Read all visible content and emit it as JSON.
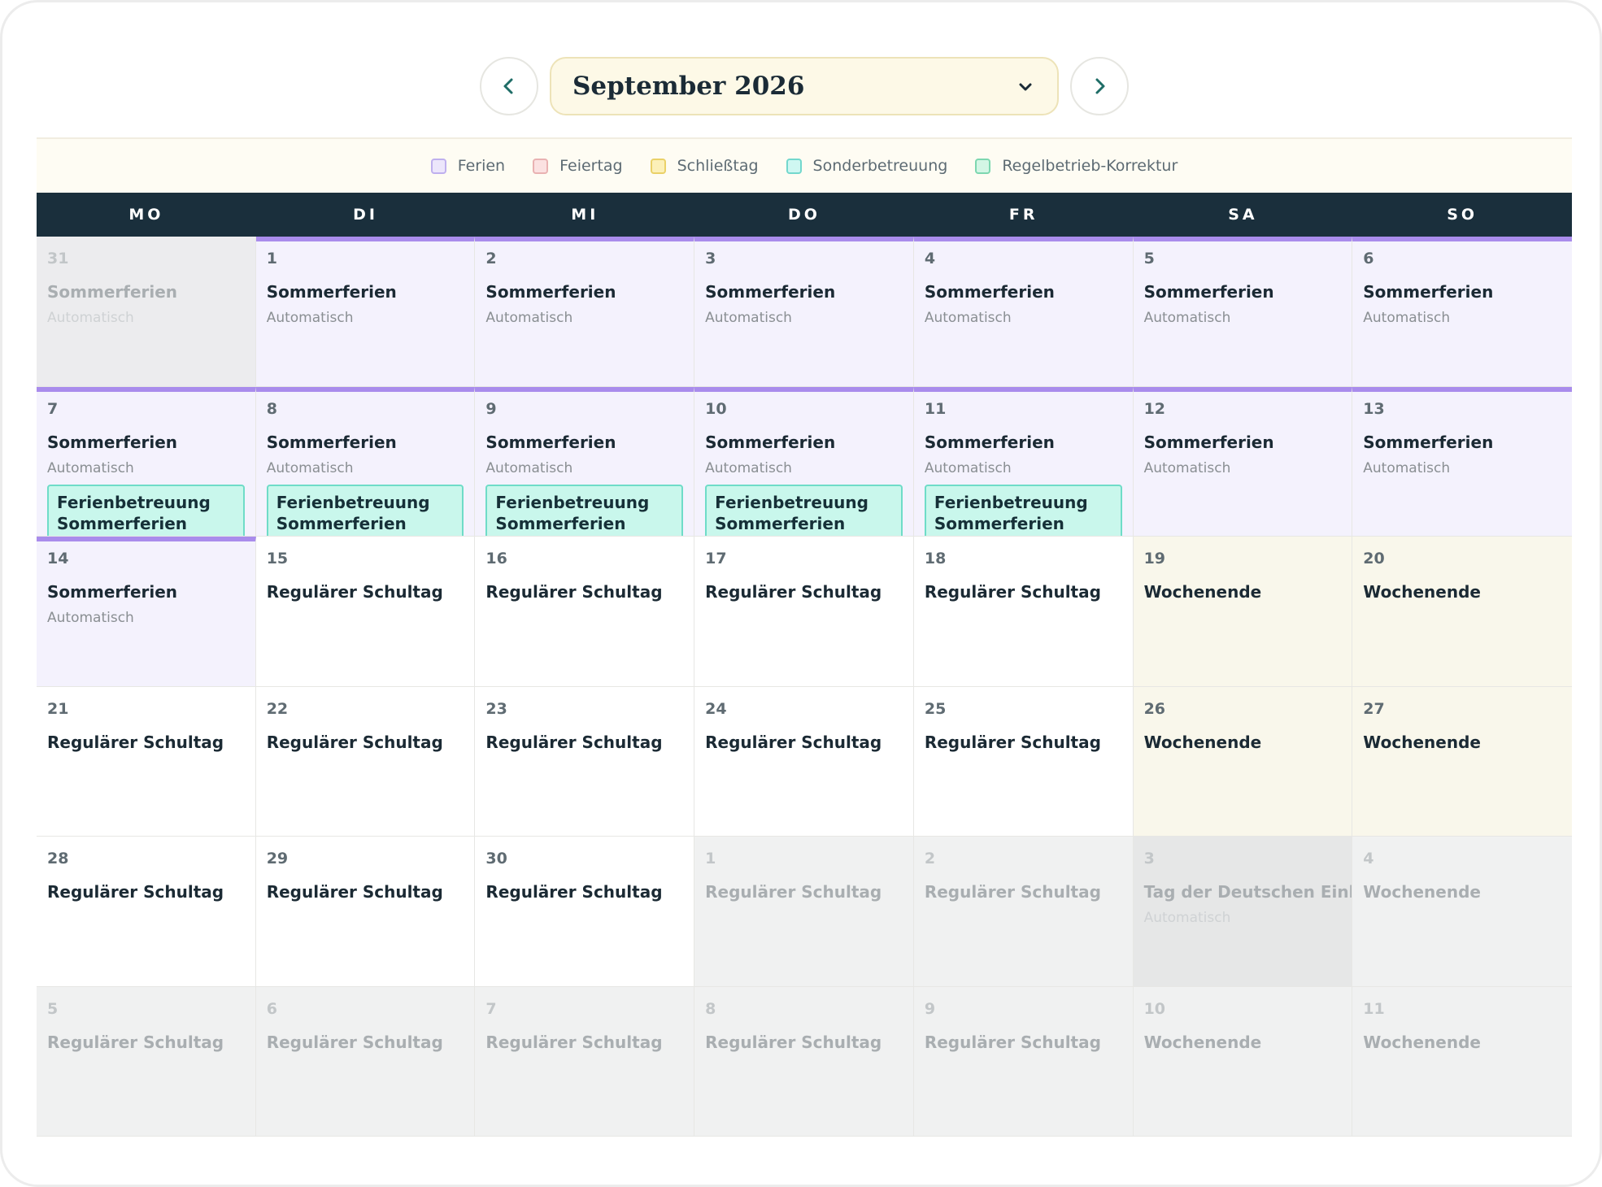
{
  "nav": {
    "month": "September 2026",
    "prev_icon": "chevron-left-icon",
    "next_icon": "chevron-right-icon",
    "dropdown_icon": "chevron-down-icon"
  },
  "legend": [
    {
      "label": "Ferien",
      "fill": "#ece6fb",
      "border": "#bfb0ee"
    },
    {
      "label": "Feiertag",
      "fill": "#fbe1e1",
      "border": "#e9b2b2"
    },
    {
      "label": "Schließtag",
      "fill": "#fcf0b8",
      "border": "#ead168"
    },
    {
      "label": "Sonderbetreuung",
      "fill": "#cff7f2",
      "border": "#73d8cd"
    },
    {
      "label": "Regelbetrieb-Korrektur",
      "fill": "#d3f6e5",
      "border": "#7dd7b0"
    }
  ],
  "weekdays": [
    "MO",
    "DI",
    "MI",
    "DO",
    "FR",
    "SA",
    "SO"
  ],
  "days": [
    {
      "day": "31",
      "title": "Sommerferien",
      "sub": "Automatisch",
      "kind": "outside ferien",
      "bar": false
    },
    {
      "day": "1",
      "title": "Sommerferien",
      "sub": "Automatisch",
      "kind": "ferien",
      "bar": true
    },
    {
      "day": "2",
      "title": "Sommerferien",
      "sub": "Automatisch",
      "kind": "ferien",
      "bar": true
    },
    {
      "day": "3",
      "title": "Sommerferien",
      "sub": "Automatisch",
      "kind": "ferien",
      "bar": true
    },
    {
      "day": "4",
      "title": "Sommerferien",
      "sub": "Automatisch",
      "kind": "ferien",
      "bar": true
    },
    {
      "day": "5",
      "title": "Sommerferien",
      "sub": "Automatisch",
      "kind": "ferien",
      "bar": true
    },
    {
      "day": "6",
      "title": "Sommerferien",
      "sub": "Automatisch",
      "kind": "ferien",
      "bar": true
    },
    {
      "day": "7",
      "title": "Sommerferien",
      "sub": "Automatisch",
      "kind": "ferien",
      "bar": true,
      "event": [
        "Ferienbetreuung",
        "Sommerferien"
      ]
    },
    {
      "day": "8",
      "title": "Sommerferien",
      "sub": "Automatisch",
      "kind": "ferien",
      "bar": true,
      "event": [
        "Ferienbetreuung",
        "Sommerferien"
      ]
    },
    {
      "day": "9",
      "title": "Sommerferien",
      "sub": "Automatisch",
      "kind": "ferien",
      "bar": true,
      "event": [
        "Ferienbetreuung",
        "Sommerferien"
      ]
    },
    {
      "day": "10",
      "title": "Sommerferien",
      "sub": "Automatisch",
      "kind": "ferien",
      "bar": true,
      "event": [
        "Ferienbetreuung",
        "Sommerferien"
      ]
    },
    {
      "day": "11",
      "title": "Sommerferien",
      "sub": "Automatisch",
      "kind": "ferien",
      "bar": true,
      "event": [
        "Ferienbetreuung",
        "Sommerferien"
      ]
    },
    {
      "day": "12",
      "title": "Sommerferien",
      "sub": "Automatisch",
      "kind": "ferien",
      "bar": true
    },
    {
      "day": "13",
      "title": "Sommerferien",
      "sub": "Automatisch",
      "kind": "ferien",
      "bar": true
    },
    {
      "day": "14",
      "title": "Sommerferien",
      "sub": "Automatisch",
      "kind": "ferien",
      "bar": true
    },
    {
      "day": "15",
      "title": "Regulärer Schultag",
      "kind": "regular"
    },
    {
      "day": "16",
      "title": "Regulärer Schultag",
      "kind": "regular"
    },
    {
      "day": "17",
      "title": "Regulärer Schultag",
      "kind": "regular"
    },
    {
      "day": "18",
      "title": "Regulärer Schultag",
      "kind": "regular"
    },
    {
      "day": "19",
      "title": "Wochenende",
      "kind": "weekend"
    },
    {
      "day": "20",
      "title": "Wochenende",
      "kind": "weekend"
    },
    {
      "day": "21",
      "title": "Regulärer Schultag",
      "kind": "regular"
    },
    {
      "day": "22",
      "title": "Regulärer Schultag",
      "kind": "regular"
    },
    {
      "day": "23",
      "title": "Regulärer Schultag",
      "kind": "regular"
    },
    {
      "day": "24",
      "title": "Regulärer Schultag",
      "kind": "regular"
    },
    {
      "day": "25",
      "title": "Regulärer Schultag",
      "kind": "regular"
    },
    {
      "day": "26",
      "title": "Wochenende",
      "kind": "weekend"
    },
    {
      "day": "27",
      "title": "Wochenende",
      "kind": "weekend"
    },
    {
      "day": "28",
      "title": "Regulärer Schultag",
      "kind": "regular"
    },
    {
      "day": "29",
      "title": "Regulärer Schultag",
      "kind": "regular"
    },
    {
      "day": "30",
      "title": "Regulärer Schultag",
      "kind": "regular"
    },
    {
      "day": "1",
      "title": "Regulärer Schultag",
      "kind": "outside"
    },
    {
      "day": "2",
      "title": "Regulärer Schultag",
      "kind": "outside"
    },
    {
      "day": "3",
      "title": "Tag der Deutschen Einheit",
      "sub": "Automatisch",
      "kind": "outside closed"
    },
    {
      "day": "4",
      "title": "Wochenende",
      "kind": "outside"
    },
    {
      "day": "5",
      "title": "Regulärer Schultag",
      "kind": "outside"
    },
    {
      "day": "6",
      "title": "Regulärer Schultag",
      "kind": "outside"
    },
    {
      "day": "7",
      "title": "Regulärer Schultag",
      "kind": "outside"
    },
    {
      "day": "8",
      "title": "Regulärer Schultag",
      "kind": "outside"
    },
    {
      "day": "9",
      "title": "Regulärer Schultag",
      "kind": "outside"
    },
    {
      "day": "10",
      "title": "Wochenende",
      "kind": "outside"
    },
    {
      "day": "11",
      "title": "Wochenende",
      "kind": "outside"
    }
  ]
}
